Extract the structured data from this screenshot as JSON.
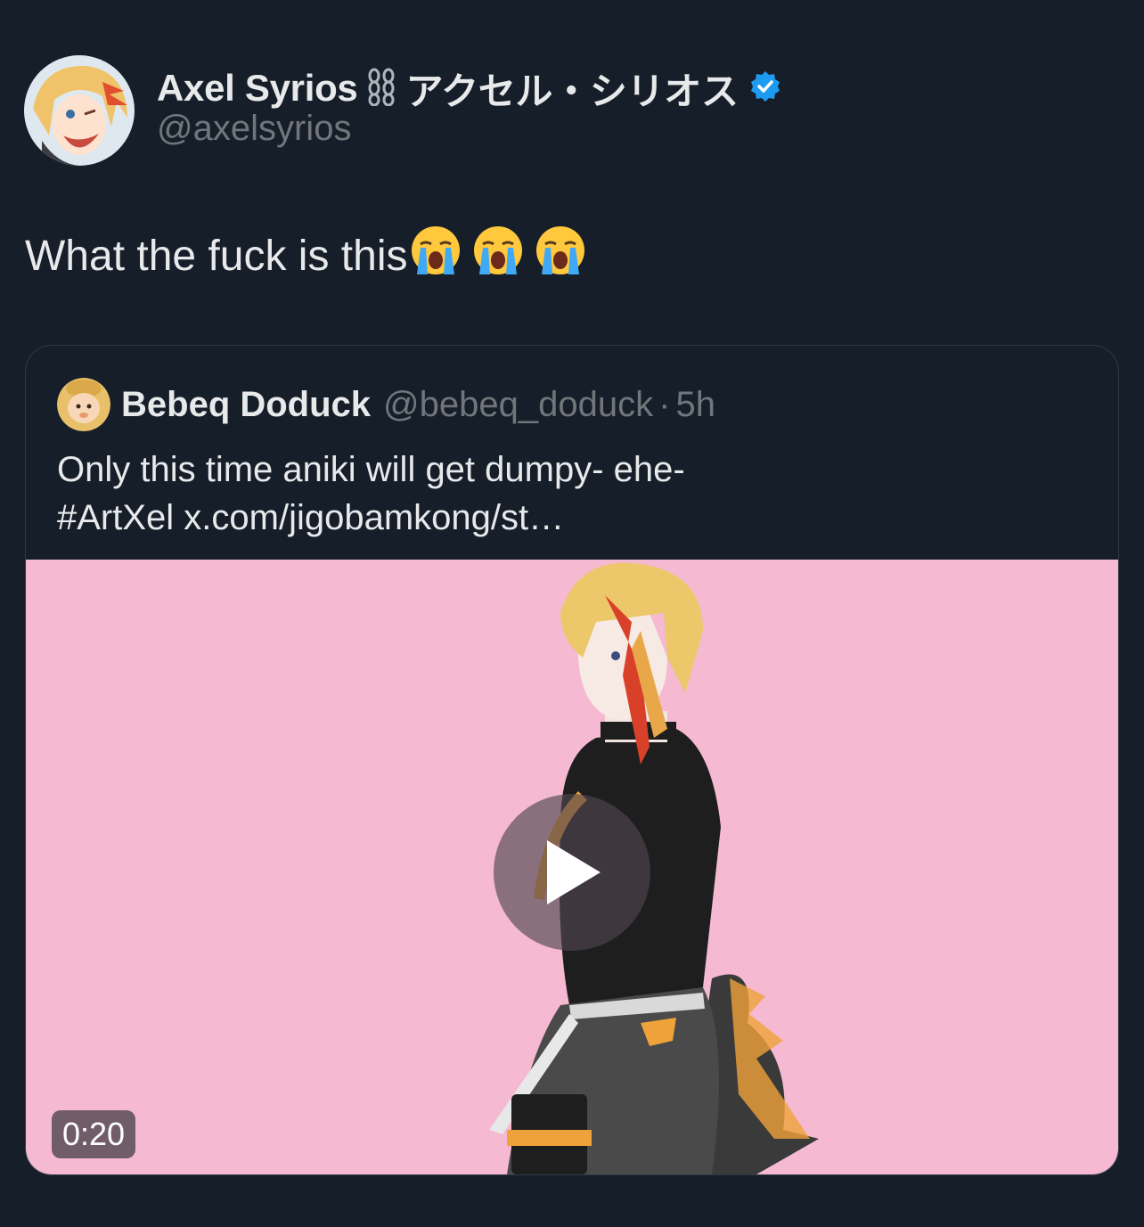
{
  "tweet": {
    "author": {
      "display_name": "Axel Syrios",
      "display_name_suffix": "アクセル・シリオス",
      "handle": "@axelsyrios",
      "verified": true,
      "badge_color": "#1d9bf0",
      "avatar_icon": "avatar-anime-character"
    },
    "text": "What the fuck is this",
    "emojis": [
      "😭",
      "😭",
      "😭"
    ]
  },
  "quote": {
    "author": {
      "display_name": "Bebeq Doduck",
      "handle": "@bebeq_doduck",
      "separator": "·",
      "time": "5h",
      "avatar_icon": "avatar-cartoon-duck"
    },
    "text_line1": "Only this time aniki will get dumpy- ehe-",
    "text_line2": "#ArtXel x.com/jigobamkong/st…",
    "media": {
      "type": "video",
      "background_color": "#f5bad2",
      "duration": "0:20",
      "play_icon": "play-icon"
    }
  }
}
